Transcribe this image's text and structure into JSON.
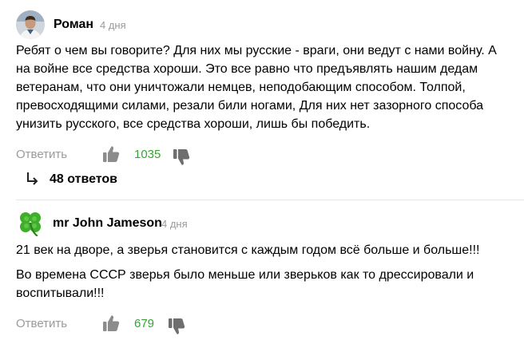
{
  "colors": {
    "time": "#9a9a9a",
    "likes": "#35a435",
    "icon": "#8c8c8c"
  },
  "comments": [
    {
      "author": "Роман",
      "time": "4 дня",
      "avatar": "user-photo",
      "paragraphs": [
        "Ребят о чем вы говорите? Для них мы русские - враги, они ведут с нами войну. А на войне все средства хороши. Это все равно что предъявлять нашим дедам ветеранам, что они уничтожали немцев, неподобающим способом. Толпой, превосходящими силами, резали били ногами, Для них нет зазорного способа унизить русского, все средства хороши, лишь бы победить."
      ],
      "reply_label": "Ответить",
      "likes": "1035",
      "replies_label": "48 ответов"
    },
    {
      "author": "mr John Jameson",
      "time": "4 дня",
      "avatar": "clover-icon",
      "paragraphs": [
        "21 век на дворе, а зверья становится с каждым годом всё больше и больше!!!",
        "Во времена СССР зверья было меньше или зверьков как то дрессировали и воспитывали!!!"
      ],
      "reply_label": "Ответить",
      "likes": "679"
    }
  ]
}
